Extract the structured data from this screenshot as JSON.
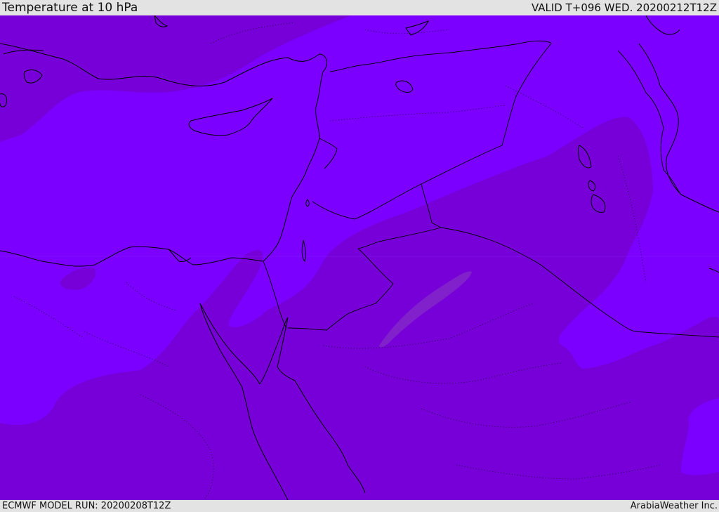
{
  "header": {
    "title": "Temperature at 10 hPa",
    "valid": "VALID T+096 WED. 20200212T12Z"
  },
  "footer": {
    "model_run": "ECMWF MODEL RUN: 20200208T12Z",
    "credit": "ArabiaWeather Inc."
  },
  "colors": {
    "warm_band": "#7b00ff",
    "cool_band": "#7700d9",
    "coldest_spot": "#8a3dbf",
    "coastline": "#000000",
    "header_bg": "#e3e3e3"
  }
}
